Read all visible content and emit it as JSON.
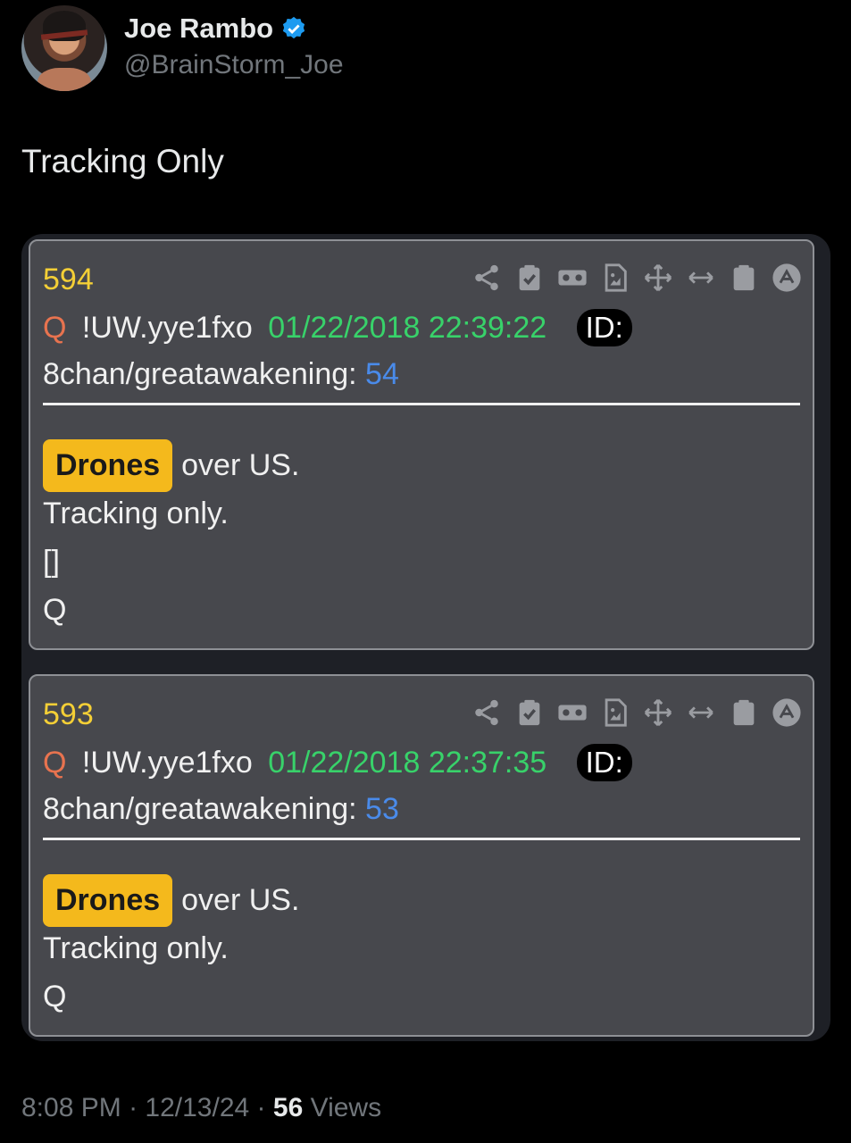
{
  "author": {
    "name": "Joe Rambo",
    "handle": "@BrainStorm_Joe",
    "verified": true,
    "verified_color": "#1d9bf0"
  },
  "tweet_text": "Tracking Only",
  "posts": [
    {
      "number": "594",
      "author_q": "Q",
      "tripcode": "!UW.yye1fxo",
      "datetime": "01/22/2018 22:39:22",
      "id_label": "ID:",
      "board": "8chan/greatawakening:",
      "board_count": "54",
      "highlight_word": "Drones",
      "line1_rest": "over US.",
      "lines": [
        "Tracking only.",
        "[]",
        "Q"
      ]
    },
    {
      "number": "593",
      "author_q": "Q",
      "tripcode": "!UW.yye1fxo",
      "datetime": "01/22/2018 22:37:35",
      "id_label": "ID:",
      "board": "8chan/greatawakening:",
      "board_count": "53",
      "highlight_word": "Drones",
      "line1_rest": "over US.",
      "lines": [
        "Tracking only.",
        "Q"
      ]
    }
  ],
  "toolbar_icons": [
    "share-icon",
    "clipboard-check-icon",
    "vr-glasses-icon",
    "image-file-icon",
    "move-icon",
    "horizontal-arrows-icon",
    "clipboard-icon",
    "arrow-up-circle-icon"
  ],
  "footer": {
    "time": "8:08 PM",
    "sep1": "·",
    "date": "12/13/24",
    "sep2": "·",
    "views_count": "56",
    "views_label": "Views"
  },
  "colors": {
    "post_number": "#f4cf36",
    "date": "#38d26a",
    "q_name": "#e8734f",
    "board_count": "#4a8bea",
    "highlight": "#f4b91c"
  }
}
